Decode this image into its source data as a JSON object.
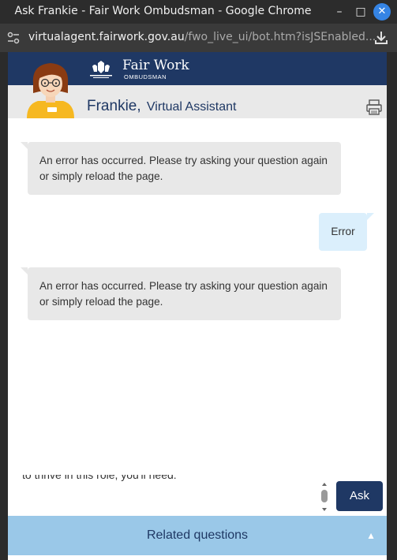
{
  "window": {
    "title": "Ask Frankie - Fair Work Ombudsman - Google Chrome"
  },
  "address_bar": {
    "url_domain": "virtualagent.fairwork.gov.au",
    "url_path": "/fwo_live_ui/bot.htm?isJSEnabled..."
  },
  "brand": {
    "name": "Fair Work",
    "sub": "OMBUDSMAN"
  },
  "bot": {
    "name": "Frankie,",
    "role": "Virtual Assistant"
  },
  "messages": [
    {
      "from": "bot",
      "text": "An error has occurred. Please try asking your question again or simply reload the page."
    },
    {
      "from": "user",
      "text": "Error"
    },
    {
      "from": "bot",
      "text": "An error has occurred. Please try asking your question again or simply reload the page."
    }
  ],
  "input": {
    "value": "to thrive in this role, you'll need:"
  },
  "ask_label": "Ask",
  "related_label": "Related questions",
  "colors": {
    "brand_navy": "#1f3864",
    "related_bg": "#9ac8e8",
    "bot_bubble": "#e8e8e8",
    "user_bubble": "#dbeffc"
  }
}
